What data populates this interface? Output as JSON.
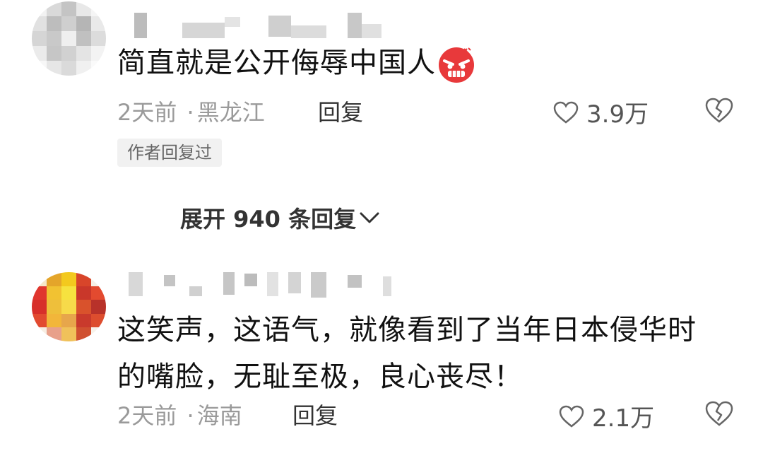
{
  "comments": [
    {
      "text": "简直就是公开侮辱中国人",
      "time": "2天前",
      "separator": "·",
      "location": "黑龙江",
      "reply_label": "回复",
      "likes": "3.9万",
      "author_badge": "作者回复过",
      "expand_label": "展开 940 条回复"
    },
    {
      "text_line1": "这笑声，这语气，就像看到了当年日本侵华时",
      "text_line2": "的嘴脸，无耻至极，良心丧尽！",
      "time": "2天前",
      "separator": "·",
      "location": "海南",
      "reply_label": "回复",
      "likes": "2.1万"
    }
  ],
  "colors": {
    "text": "#111111",
    "meta": "#9a9a9a",
    "badge_bg": "#f1f1f1",
    "emoji": "#e8393b"
  },
  "icons": [
    "angry-face-emoji",
    "heart-outline-icon",
    "broken-heart-icon",
    "chevron-down-icon"
  ]
}
